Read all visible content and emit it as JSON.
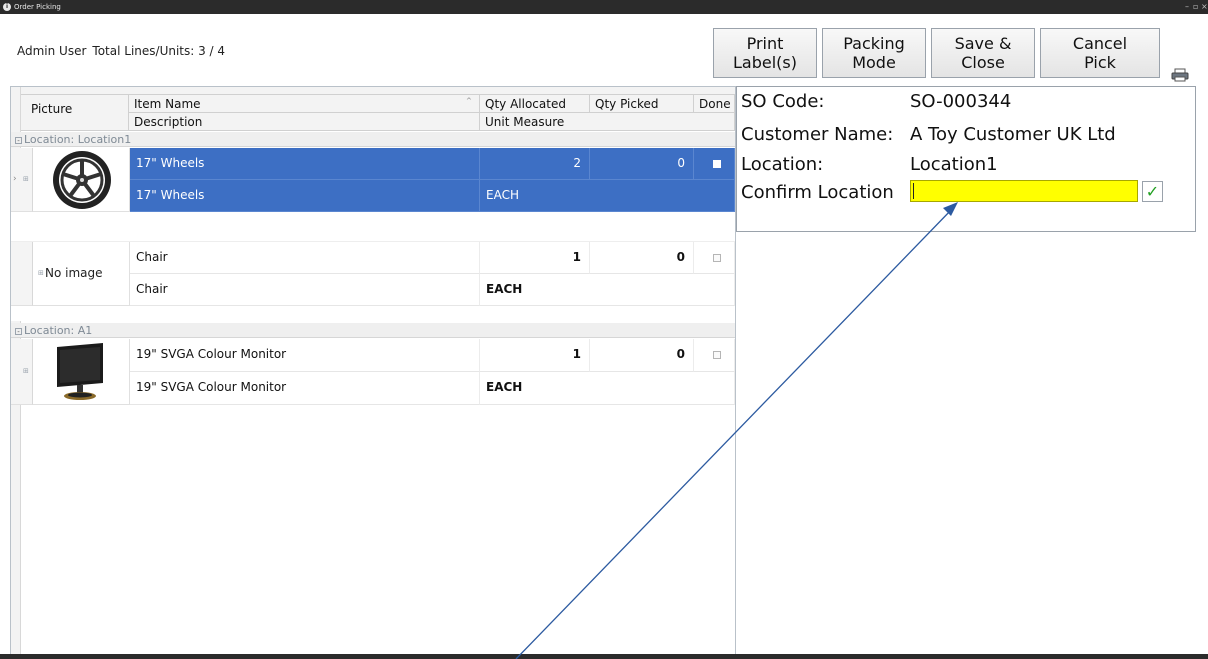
{
  "window": {
    "title": "Order Picking",
    "controls": [
      "–",
      "▫",
      "×"
    ]
  },
  "header": {
    "user": "Admin User",
    "totals": "Total Lines/Units: 3 / 4"
  },
  "toolbar": {
    "print_label": "Print\nLabel(s)",
    "packing_mode": "Packing\nMode",
    "save_close": "Save &\nClose",
    "cancel_pick": "Cancel\nPick",
    "print_icon": "printer-icon"
  },
  "grid": {
    "columns": {
      "picture": "Picture",
      "item_name": "Item Name",
      "qty_allocated": "Qty Allocated",
      "qty_picked": "Qty Picked",
      "done": "Done",
      "description": "Description",
      "unit_measure": "Unit Measure"
    },
    "groups": [
      {
        "label": "Location: Location1",
        "rows": [
          {
            "picture": "wheel-image",
            "item_name": "17\" Wheels",
            "description": "17\" Wheels",
            "qty_allocated": "2",
            "qty_picked": "0",
            "unit_measure": "EACH",
            "selected": true
          },
          {
            "picture": "No image",
            "item_name": "Chair",
            "description": "Chair",
            "qty_allocated": "1",
            "qty_picked": "0",
            "unit_measure": "EACH",
            "selected": false
          }
        ]
      },
      {
        "label": "Location: A1",
        "rows": [
          {
            "picture": "monitor-image",
            "item_name": "19\" SVGA Colour Monitor",
            "description": "19\" SVGA Colour Monitor",
            "qty_allocated": "1",
            "qty_picked": "0",
            "unit_measure": "EACH",
            "selected": false
          }
        ]
      }
    ]
  },
  "details": {
    "so_code_label": "SO Code:",
    "so_code": "SO-000344",
    "customer_label": "Customer Name:",
    "customer": "A Toy Customer UK Ltd",
    "location_label": "Location:",
    "location": "Location1",
    "confirm_label": "Confirm Location",
    "confirm_value": ""
  },
  "colors": {
    "selection": "#3d6fc4",
    "confirm_field": "#ffff00",
    "annotation_arrow": "#2c5aa0"
  }
}
